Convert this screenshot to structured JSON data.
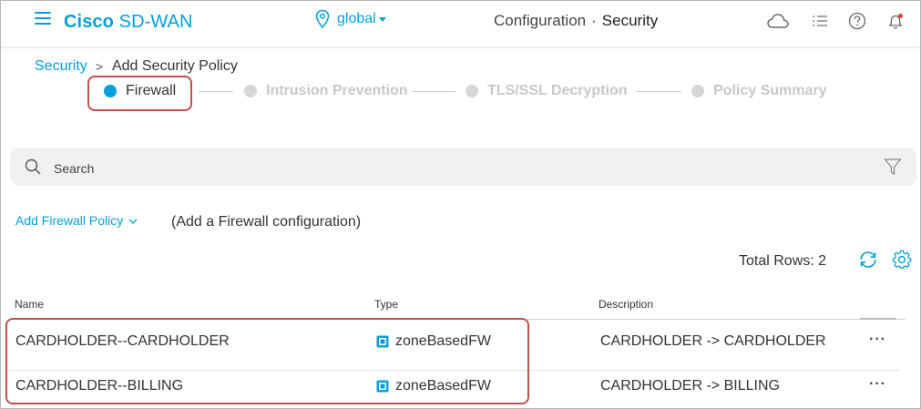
{
  "header": {
    "brand_bold": "Cisco",
    "brand_rest": " SD-WAN",
    "location": "global",
    "title_section": "Configuration",
    "title_sep": "·",
    "title_page": "Security",
    "icons": [
      "hamburger-menu-icon",
      "map-pin-icon",
      "cloud-icon",
      "task-list-icon",
      "help-icon",
      "notification-bell-icon"
    ]
  },
  "breadcrumb": {
    "parent": "Security",
    "separator": ">",
    "current": "Add Security Policy"
  },
  "stepper": {
    "steps": [
      {
        "label": "Firewall",
        "active": true
      },
      {
        "label": "Intrusion Prevention",
        "active": false
      },
      {
        "label": "TLS/SSL Decryption",
        "active": false
      },
      {
        "label": "Policy Summary",
        "active": false
      }
    ]
  },
  "search": {
    "placeholder": "Search",
    "icons": [
      "search-icon",
      "filter-icon"
    ]
  },
  "actions": {
    "add_policy_label": "Add Firewall Policy",
    "add_policy_note": "(Add a Firewall configuration)"
  },
  "table": {
    "total_rows_label": "Total Rows: 2",
    "columns": [
      "Name",
      "Type",
      "Description"
    ],
    "rows": [
      {
        "name": "CARDHOLDER--CARDHOLDER",
        "type": "zoneBasedFW",
        "description": "CARDHOLDER -> CARDHOLDER",
        "more": "···"
      },
      {
        "name": "CARDHOLDER--BILLING",
        "type": "zoneBasedFW",
        "description": "CARDHOLDER -> BILLING",
        "more": "···"
      }
    ]
  },
  "colors": {
    "accent": "#049fd9",
    "highlight": "#c0504d",
    "inactive": "#d6d6d6",
    "search_bg": "#f1f1f2"
  }
}
